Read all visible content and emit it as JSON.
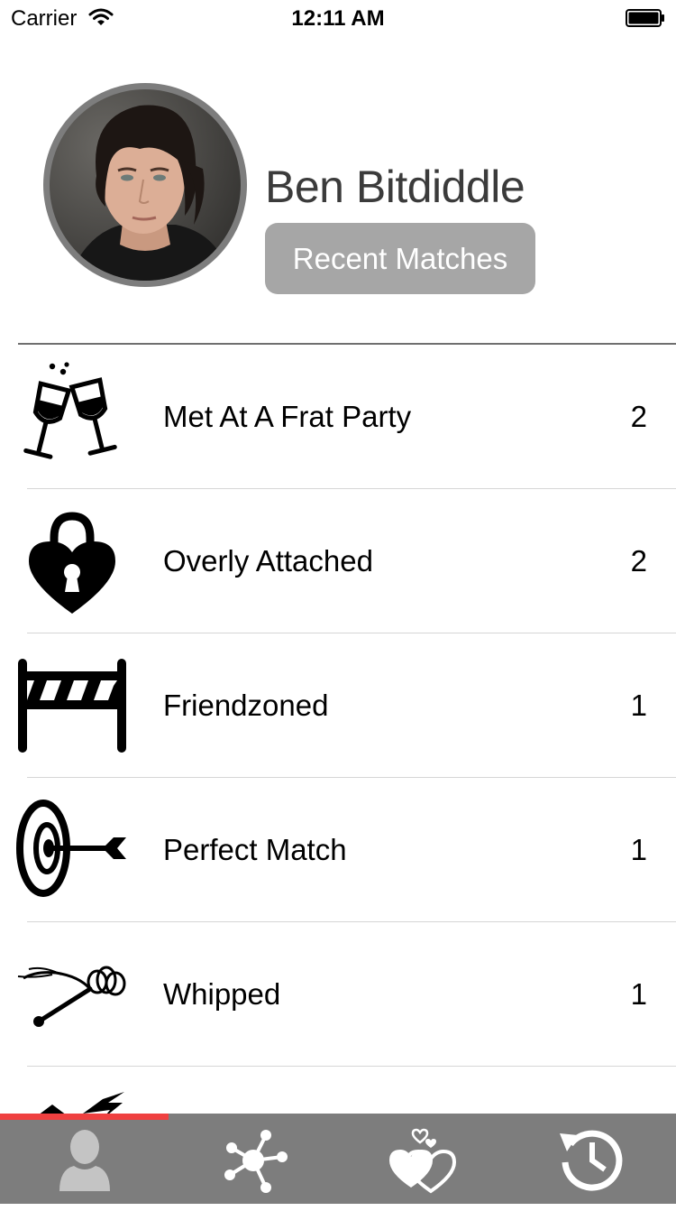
{
  "status_bar": {
    "carrier": "Carrier",
    "time": "12:11 AM"
  },
  "profile": {
    "name": "Ben Bitdiddle",
    "recent_matches_label": "Recent Matches"
  },
  "categories": [
    {
      "label": "Met At A Frat Party",
      "count": "2",
      "icon": "champagne-glasses-icon"
    },
    {
      "label": "Overly Attached",
      "count": "2",
      "icon": "heart-padlock-icon"
    },
    {
      "label": "Friendzoned",
      "count": "1",
      "icon": "barricade-icon"
    },
    {
      "label": "Perfect Match",
      "count": "1",
      "icon": "target-arrow-icon"
    },
    {
      "label": "Whipped",
      "count": "1",
      "icon": "whip-icon"
    }
  ],
  "tab_bar": {
    "tabs": [
      "profile-tab-icon",
      "network-tab-icon",
      "hearts-tab-icon",
      "history-tab-icon"
    ],
    "active_index": 0
  },
  "colors": {
    "accent": "#ef4040",
    "tab_bar_bg": "#7d7d7d",
    "button_bg": "#a6a6a6",
    "name_text": "#3b3b3b",
    "active_tab_icon": "#c4c4c4",
    "inactive_tab_icon": "#ffffff"
  }
}
